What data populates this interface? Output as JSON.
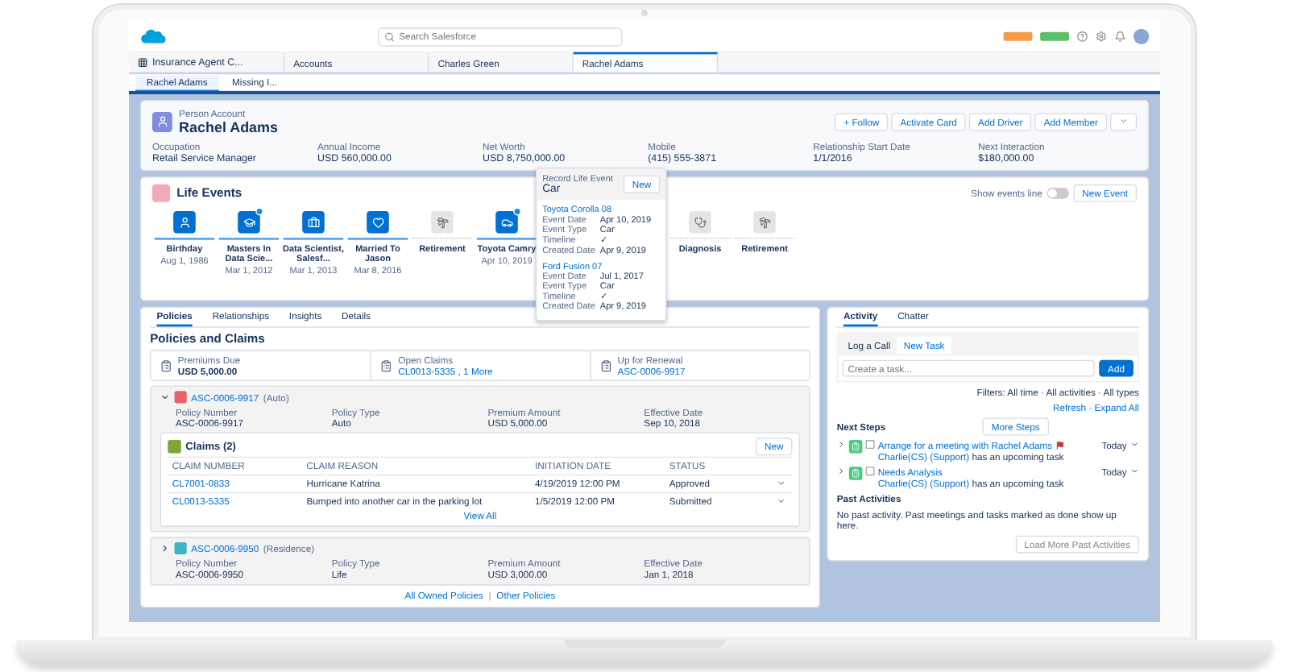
{
  "header": {
    "search_placeholder": "Search Salesforce"
  },
  "app_name": "Insurance Agent C...",
  "tabs": [
    {
      "label": "Accounts",
      "selected": false
    },
    {
      "label": "Charles Green",
      "selected": false
    },
    {
      "label": "Rachel Adams",
      "selected": true
    }
  ],
  "subtabs": [
    {
      "label": "Rachel Adams",
      "selected": true
    },
    {
      "label": "Missing I...",
      "selected": false
    }
  ],
  "account": {
    "type": "Person Account",
    "name": "Rachel Adams",
    "actions": [
      "+ Follow",
      "Activate Card",
      "Add Driver",
      "Add Member"
    ],
    "fields": [
      {
        "label": "Occupation",
        "value": "Retail Service Manager"
      },
      {
        "label": "Annual Income",
        "value": "USD 560,000.00"
      },
      {
        "label": "Net Worth",
        "value": "USD 8,750,000.00"
      },
      {
        "label": "Mobile",
        "value": "(415) 555-3871"
      },
      {
        "label": "Relationship Start Date",
        "value": "1/1/2016"
      },
      {
        "label": "Next Interaction",
        "value": "$180,000.00"
      }
    ]
  },
  "life_events": {
    "title": "Life Events",
    "toggle_label": "Show events line",
    "toggle_on": false,
    "new_button": "New Event",
    "events": [
      {
        "name": "Birthday",
        "date": "Aug 1, 1986",
        "kind": "past",
        "badge": false
      },
      {
        "name": "Masters In Data Scie...",
        "date": "Mar 1, 2012",
        "kind": "past",
        "badge": true
      },
      {
        "name": "Data Scientist, Salesf...",
        "date": "Mar 1, 2013",
        "kind": "past",
        "badge": false
      },
      {
        "name": "Married To Jason",
        "date": "Mar 8, 2016",
        "kind": "past",
        "badge": false
      },
      {
        "name": "Retirement",
        "kind": "future",
        "badge": false
      },
      {
        "name": "Toyota Camry",
        "date": "Apr 10, 2019",
        "kind": "past",
        "badge": true
      },
      {
        "name": "Diagnosis",
        "kind": "future",
        "badge": false
      },
      {
        "name": "Retirement",
        "kind": "future",
        "badge": false
      }
    ]
  },
  "popup": {
    "label": "Record Life Event",
    "title": "Car",
    "button": "New",
    "records": [
      {
        "name": "Toyota Corolla 08",
        "rows": [
          {
            "label": "Event Date",
            "value": "Apr 10, 2019"
          },
          {
            "label": "Event Type",
            "value": "Car"
          },
          {
            "label": "Timeline",
            "value": "✓"
          },
          {
            "label": "Created Date",
            "value": "Apr 9, 2019"
          }
        ]
      },
      {
        "name": "Ford Fusion 07",
        "rows": [
          {
            "label": "Event Date",
            "value": "Jul 1, 2017"
          },
          {
            "label": "Event Type",
            "value": "Car"
          },
          {
            "label": "Timeline",
            "value": "✓"
          },
          {
            "label": "Created Date",
            "value": "Apr 9, 2019"
          }
        ]
      }
    ]
  },
  "policies": {
    "tabs": [
      {
        "label": "Policies",
        "selected": true
      },
      {
        "label": "Relationships",
        "selected": false
      },
      {
        "label": "Insights",
        "selected": false
      },
      {
        "label": "Details",
        "selected": false
      }
    ],
    "title": "Policies and Claims",
    "summary": [
      {
        "label": "Premiums Due",
        "value": "USD 5,000.00",
        "link": false
      },
      {
        "label": "Open Claims",
        "value": "CL0013-5335 , 1 More",
        "link": true
      },
      {
        "label": "Up for Renewal",
        "value": "ASC-0006-9917",
        "link": true
      }
    ],
    "items": [
      {
        "number": "ASC-0006-9917",
        "type": "(Auto)",
        "color": "#e8626e",
        "expanded": true,
        "fields": [
          {
            "label": "Policy Number",
            "value": "ASC-0006-9917"
          },
          {
            "label": "Policy Type",
            "value": "Auto"
          },
          {
            "label": "Premium Amount",
            "value": "USD 5,000.00"
          },
          {
            "label": "Effective Date",
            "value": "Sep 10, 2018"
          }
        ],
        "claims": {
          "title": "Claims (2)",
          "button": "New",
          "columns": [
            "CLAIM NUMBER",
            "CLAIM REASON",
            "INITIATION DATE",
            "STATUS"
          ],
          "rows": [
            [
              "CL7001-0833",
              "Hurricane Katrina",
              "4/19/2019 12:00 PM",
              "Approved"
            ],
            [
              "CL0013-5335",
              "Bumped into another car in the parking lot",
              "1/5/2019 12:00 PM",
              "Submitted"
            ]
          ],
          "view_all": "View All"
        }
      },
      {
        "number": "ASC-0006-9950",
        "type": "(Residence)",
        "color": "#3fb5c9",
        "expanded": false,
        "fields": [
          {
            "label": "Policy Number",
            "value": "ASC-0006-9950"
          },
          {
            "label": "Policy Type",
            "value": "Life"
          },
          {
            "label": "Premium Amount",
            "value": "USD 3,000.00"
          },
          {
            "label": "Effective Date",
            "value": "Jan 1, 2018"
          }
        ]
      }
    ],
    "footer_links": [
      "All Owned Policies",
      "Other Policies"
    ],
    "footer_sep": "|"
  },
  "activity": {
    "tabs": [
      {
        "label": "Activity",
        "selected": true
      },
      {
        "label": "Chatter",
        "selected": false
      }
    ],
    "subtabs": [
      {
        "label": "Log a Call",
        "selected": false
      },
      {
        "label": "New Task",
        "selected": true
      }
    ],
    "task_placeholder": "Create a task...",
    "add_button": "Add",
    "filters": "Filters: All time · All activities · All types",
    "refresh": "Refresh · Expand All",
    "next_steps": "Next Steps",
    "more_steps": "More Steps",
    "items": [
      {
        "title": "Arrange for a meeting with Rachel Adams",
        "done": false,
        "flagged": true,
        "owner": "Charlie(CS) (Support)",
        "note": "has an upcoming task",
        "due": "Today"
      },
      {
        "title": "Needs Analysis",
        "done": false,
        "flagged": false,
        "owner": "Charlie(CS) (Support)",
        "note": "has an upcoming task",
        "due": "Today"
      }
    ],
    "past_title": "Past Activities",
    "past_empty": "No past activity. Past meetings and tasks marked as done show up here.",
    "load_more": "Load More Past Activities"
  }
}
